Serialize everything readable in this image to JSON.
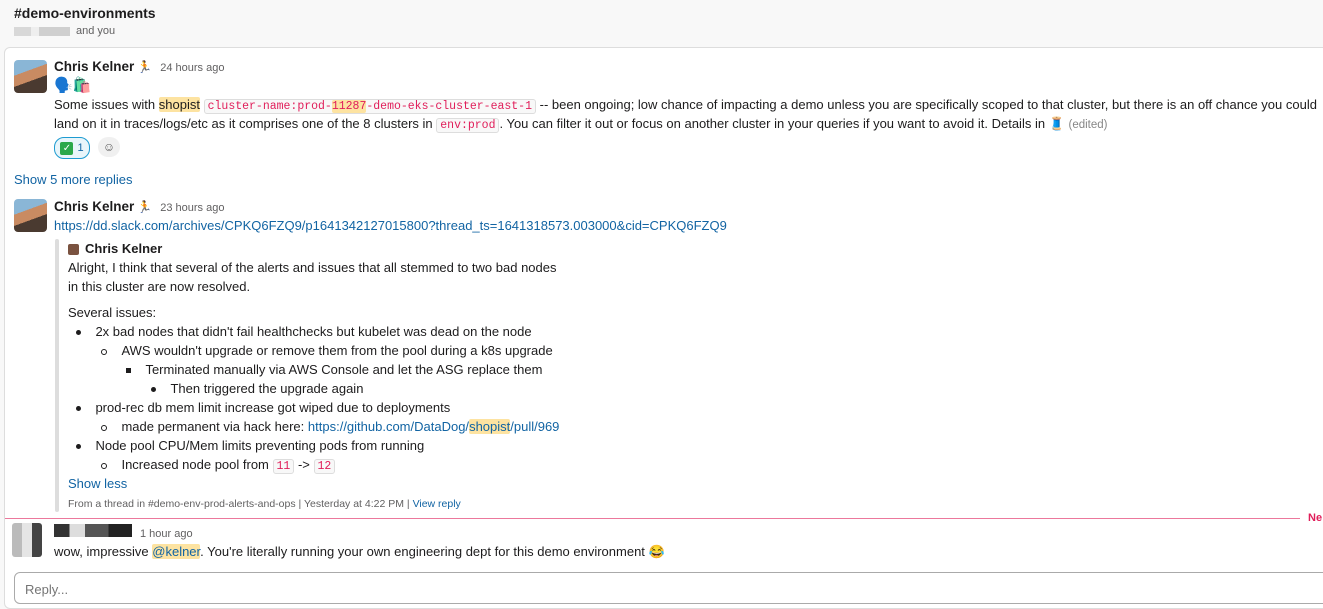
{
  "channel": {
    "name": "#demo-environments",
    "members_suffix": "and you"
  },
  "messages": [
    {
      "author": "Chris Kelner",
      "status_emoji": "🏃",
      "time": "24 hours ago",
      "top_emojis": "🗣️🛍️",
      "text_1": "Some issues with",
      "hl_1": "shopist",
      "code_pre": "cluster-name:prod-",
      "code_hl": "11287",
      "code_post": "-demo-eks-cluster-east-1",
      "text_2": "-- been ongoing; low chance of impacting a demo unless you are specifically scoped to that cluster, but there is an off chance you could",
      "text_3": "land on it in traces/logs/etc as it comprises one of the 8 clusters in",
      "code_2": "env:prod",
      "text_4": ". You can filter it out or focus on another cluster in your queries if you want to avoid it. Details in",
      "thread_emoji": "🧵",
      "edited": "(edited)",
      "reaction_count": "1",
      "show_more_replies": "Show 5 more replies"
    },
    {
      "author": "Chris Kelner",
      "status_emoji": "🏃",
      "time": "23 hours ago",
      "link": "https://dd.slack.com/archives/CPKQ6FZQ9/p1641342127015800?thread_ts=1641318573.003000&cid=CPKQ6FZQ9",
      "quote": {
        "author": "Chris Kelner",
        "line_1": "Alright, I think that several of the alerts and issues that all stemmed to two bad nodes",
        "line_2": "in this cluster are now resolved.",
        "line_3": "Several issues:",
        "b1": "2x bad nodes that didn't fail healthchecks but kubelet was dead on the node",
        "b1_1": "AWS wouldn't upgrade or remove them from the pool during a k8s upgrade",
        "b1_1_1": "Terminated manually via AWS Console and let the ASG replace them",
        "b1_1_1_1": "Then triggered the upgrade again",
        "b2": "prod-rec db mem limit increase got wiped due to deployments",
        "b2_1_text": "made permanent via hack here:",
        "b2_1_link_pre": "https://github.com/DataDog/",
        "b2_1_link_hl": "shopist",
        "b2_1_link_post": "/pull/969",
        "b3": "Node pool CPU/Mem limits preventing pods from running",
        "b3_1_text": "Increased node pool from",
        "b3_1_from": "11",
        "b3_1_arrow": "->",
        "b3_1_to": "12",
        "show_less": "Show less",
        "footer_from": "From a thread in #demo-env-prod-alerts-and-ops",
        "footer_time": "Yesterday at 4:22 PM",
        "footer_view": "View reply"
      }
    },
    {
      "time": "1 hour ago",
      "text_1": "wow, impressive",
      "mention": "@kelner",
      "text_2": ". You're literally running your own engineering dept for this demo environment",
      "emoji": "😂"
    }
  ],
  "new_label": "Ne",
  "reply": {
    "placeholder": "Reply..."
  }
}
